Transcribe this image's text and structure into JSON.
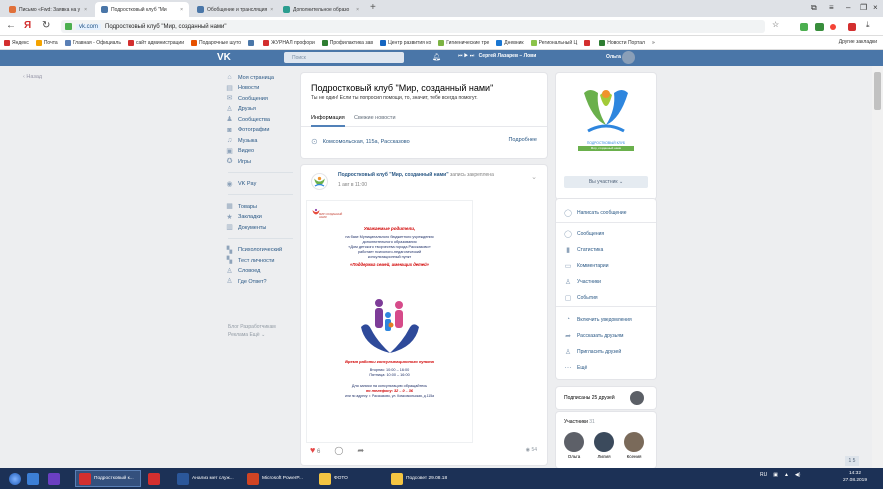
{
  "browser": {
    "tabs": [
      {
        "title": "Письмо «Fwd: Заявка на у",
        "color": "#e0703a"
      },
      {
        "title": "Подростковый клуб \"Ми",
        "color": "#4a76a8"
      },
      {
        "title": "Обобщение и трансляция",
        "color": "#4a76a8"
      },
      {
        "title": "Дополнительное образо",
        "color": "#2a9d8f"
      }
    ],
    "new_tab": "+",
    "url_domain": "vk.com",
    "url_title": "Подростковый клуб \"Мир, созданный нами\"",
    "bookmarks": [
      {
        "label": "Яндекс",
        "color": "#d32f2f"
      },
      {
        "label": "Почта",
        "color": "#f4a300"
      },
      {
        "label": "Главная - Официаль",
        "color": "#5a7fb5"
      },
      {
        "label": "сайт администрации",
        "color": "#d32f2f"
      },
      {
        "label": "Подарочные шуто",
        "color": "#e65100"
      },
      {
        "label": "",
        "color": "#4a76a8"
      },
      {
        "label": "ЖУРНАЛ профори",
        "color": "#d32f2f"
      },
      {
        "label": "Профилактика зав",
        "color": "#2e7d32"
      },
      {
        "label": "Центр развития ко",
        "color": "#1565c0"
      },
      {
        "label": "Гигиенические тре",
        "color": "#7cb342"
      },
      {
        "label": "Дневник",
        "color": "#1976d2"
      },
      {
        "label": "Региональный Ц",
        "color": "#8bc34a"
      },
      {
        "label": "",
        "color": "#d32f2f"
      },
      {
        "label": "Новости Портал",
        "color": "#2e7d32"
      }
    ],
    "bookmarks_more": "»",
    "other_bookmarks": "Другие закладки"
  },
  "vk": {
    "logo": "VK",
    "search_placeholder": "Поиск",
    "player_text": "Сергей Лазарев – Лови",
    "user_name": "Ольга",
    "back": "Назад",
    "nav": [
      {
        "label": "Моя страница",
        "icon": "home-icon",
        "glyph": "⌂"
      },
      {
        "label": "Новости",
        "icon": "news-icon",
        "glyph": "▤"
      },
      {
        "label": "Сообщения",
        "icon": "messages-icon",
        "glyph": "✉"
      },
      {
        "label": "Друзья",
        "icon": "friends-icon",
        "glyph": "♙"
      },
      {
        "label": "Сообщества",
        "icon": "communities-icon",
        "glyph": "♟"
      },
      {
        "label": "Фотографии",
        "icon": "photos-icon",
        "glyph": "◙"
      },
      {
        "label": "Музыка",
        "icon": "music-icon",
        "glyph": "♫"
      },
      {
        "label": "Видео",
        "icon": "video-icon",
        "glyph": "▣"
      },
      {
        "label": "Игры",
        "icon": "games-icon",
        "glyph": "✪"
      }
    ],
    "nav2": [
      {
        "label": "VK Pay",
        "icon": "vkpay-icon",
        "glyph": "◉"
      }
    ],
    "nav3": [
      {
        "label": "Товары",
        "icon": "goods-icon",
        "glyph": "▦"
      },
      {
        "label": "Закладки",
        "icon": "bookmarks-icon",
        "glyph": "★"
      },
      {
        "label": "Документы",
        "icon": "documents-icon",
        "glyph": "▥"
      }
    ],
    "nav4": [
      {
        "label": "Психологический",
        "icon": "app-icon",
        "glyph": "▚"
      },
      {
        "label": "Тест личности",
        "icon": "app-icon",
        "glyph": "▚"
      },
      {
        "label": "Словоед",
        "icon": "app-icon",
        "glyph": "♙"
      },
      {
        "label": "Где Ответ?",
        "icon": "app-icon",
        "glyph": "♙"
      }
    ],
    "nav_footer": [
      "Блог  Разработчикам",
      "Реклама  Ещё ⌄"
    ],
    "group": {
      "name": "Подростковый клуб \"Мир, созданный нами\"",
      "status": "Ты не один! Если ты попросил помощи, то, значит, тебе всегда помогут.",
      "tabs": [
        "Информация",
        "Свежие новости"
      ],
      "address": "Комсомольская, 115а, Рассказово",
      "more": "Подробнее"
    },
    "post": {
      "author": "Подростковый клуб \"Мир, созданный нами\"",
      "author_suffix": "запись закреплена",
      "date": "1 авг в 11:00",
      "poster": {
        "logo_text": "МИР СОЗДАННЫЙ НАМИ",
        "heading": "Уважаемые родители,",
        "lines": [
          "на базе Муниципального бюджетного учреждения",
          "дополнительного образования",
          "«Дом детского творчества города Рассказово»",
          "работает психолого-педагогический",
          "консультационный пункт"
        ],
        "slogan": "«Поддержка семей, имеющих детей»",
        "schedule_title": "Время работы консультационного пункта",
        "schedule": [
          "Вторник:   10:00 – 16:00",
          "Пятница:   10:00 – 16:00"
        ],
        "contact": [
          "Для записи на консультацию обращайтесь",
          "по телефону:  32 – 0 – 36",
          "или по адресу:  г. Рассказово,  ул. Комсомольская,  д.115а"
        ]
      },
      "likes": "6",
      "views": "54"
    },
    "sidebar": {
      "cover_text": [
        "ПОДРОСТКОВЫЙ КЛУБ",
        "Мир, созданный нами"
      ],
      "join": "Вы участник ⌄",
      "primary_action": "Написать сообщение",
      "actions": [
        {
          "label": "Сообщения",
          "icon": "message-icon",
          "glyph": "◯"
        },
        {
          "label": "Статистика",
          "icon": "stats-icon",
          "glyph": "▮"
        },
        {
          "label": "Комментарии",
          "icon": "comments-icon",
          "glyph": "▭"
        },
        {
          "label": "Участники",
          "icon": "members-icon",
          "glyph": "♙"
        },
        {
          "label": "События",
          "icon": "events-icon",
          "glyph": "▢"
        }
      ],
      "actions2": [
        {
          "label": "Включить уведомления",
          "icon": "bell-icon",
          "glyph": "◔"
        },
        {
          "label": "Рассказать друзьям",
          "icon": "share-icon",
          "glyph": "➦"
        },
        {
          "label": "Пригласить друзей",
          "icon": "invite-icon",
          "glyph": "♙"
        },
        {
          "label": "Ещё",
          "icon": "more-icon",
          "glyph": "⋯"
        }
      ],
      "subscribed": "Подписаны 25 друзей",
      "members_title": "Участники",
      "members_count": "31",
      "members": [
        "Ольга",
        "Лилия",
        "Ксения"
      ]
    },
    "scroll_up_label": "1 5"
  },
  "taskbar": {
    "items": [
      {
        "label": "",
        "color": "#3c7fd6"
      },
      {
        "label": "",
        "color": "#6a3fc2"
      },
      {
        "label": "Подростковый к...",
        "color": "#d32f2f"
      },
      {
        "label": "",
        "color": "#d32f2f"
      },
      {
        "label": "Анализ мет служ...",
        "color": "#2b579a"
      },
      {
        "label": "Microsoft PowerP...",
        "color": "#d04423"
      },
      {
        "label": "ФОТО",
        "color": "#f4c542"
      },
      {
        "label": "Подсовет 29.08.18",
        "color": "#f4c542"
      }
    ],
    "tray_lang": "RU",
    "time": "14:32",
    "date": "27.08.2019"
  }
}
